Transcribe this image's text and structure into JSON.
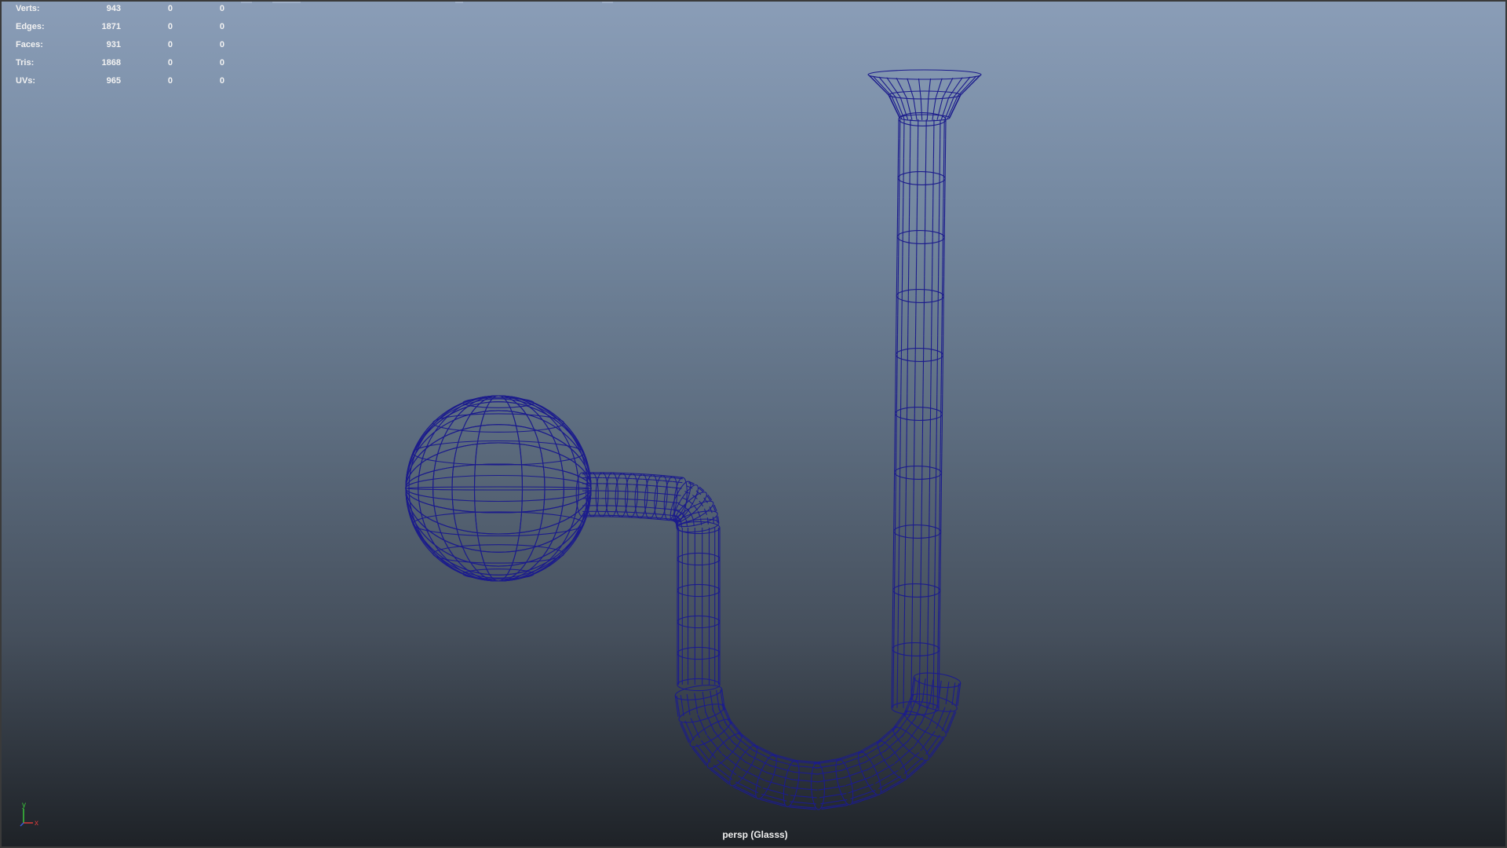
{
  "stats": [
    {
      "label": "Verts:",
      "values": [
        "943",
        "0",
        "0"
      ]
    },
    {
      "label": "Edges:",
      "values": [
        "1871",
        "0",
        "0"
      ]
    },
    {
      "label": "Faces:",
      "values": [
        "931",
        "0",
        "0"
      ]
    },
    {
      "label": "Tris:",
      "values": [
        "1868",
        "0",
        "0"
      ]
    },
    {
      "label": "UVs:",
      "values": [
        "965",
        "0",
        "0"
      ]
    }
  ],
  "camera_label": "persp (Glasss)",
  "axis": {
    "y": "y",
    "x": "x"
  },
  "colors": {
    "wireframe": "#1c1c8c",
    "background_top": "#8a9db7",
    "background_bottom": "#1e2227",
    "axis_x": "#d43a3a",
    "axis_y": "#3ac43a",
    "axis_z": "#3a5ad4"
  },
  "object": {
    "name": "Glasss",
    "display": "wireframe"
  }
}
